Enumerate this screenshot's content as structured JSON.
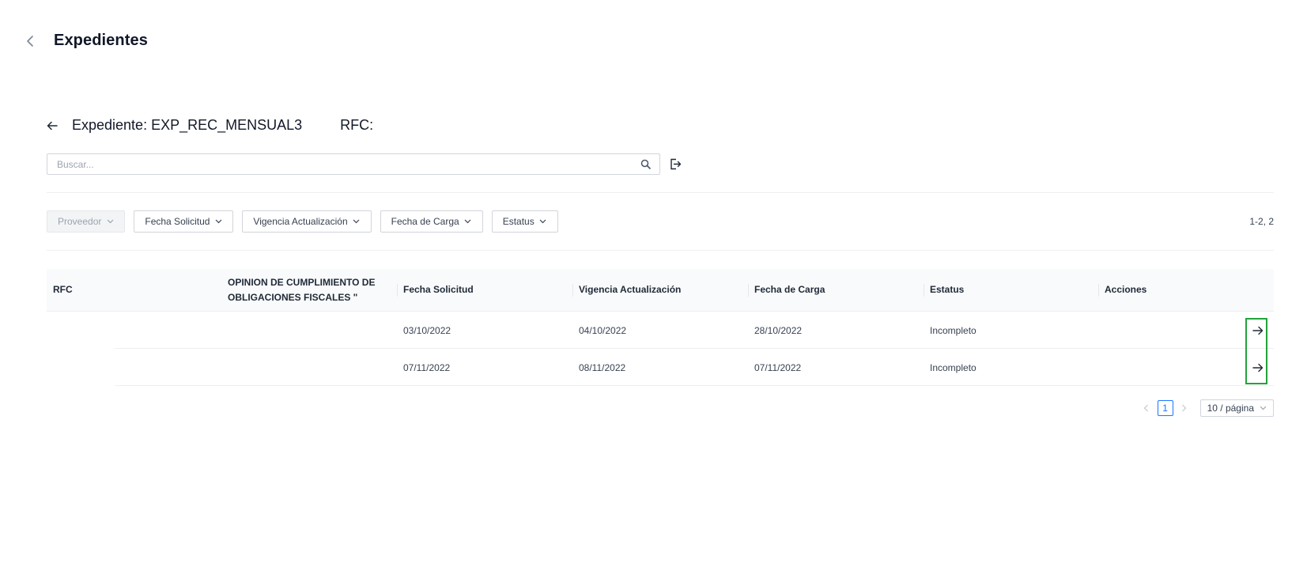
{
  "header": {
    "title": "Expedientes"
  },
  "subheader": {
    "expediente_label": "Expediente: EXP_REC_MENSUAL3",
    "rfc_label": "RFC:"
  },
  "search": {
    "placeholder": "Buscar...",
    "value": ""
  },
  "filters": [
    {
      "label": "Proveedor",
      "disabled": true
    },
    {
      "label": "Fecha Solicitud",
      "disabled": false
    },
    {
      "label": "Vigencia Actualización",
      "disabled": false
    },
    {
      "label": "Fecha de Carga",
      "disabled": false
    },
    {
      "label": "Estatus",
      "disabled": false
    }
  ],
  "range_label": "1-2, 2",
  "table": {
    "headers": {
      "rfc": "RFC",
      "opinion_line1": "OPINION DE CUMPLIMIENTO DE",
      "opinion_line2": "OBLIGACIONES FISCALES \"",
      "fecha_solicitud": "Fecha Solicitud",
      "vigencia": "Vigencia Actualización",
      "fecha_carga": "Fecha de Carga",
      "estatus": "Estatus",
      "acciones": "Acciones"
    },
    "rows": [
      {
        "rfc": "",
        "opinion": "",
        "fecha_solicitud": "03/10/2022",
        "vigencia": "04/10/2022",
        "fecha_carga": "28/10/2022",
        "estatus": "Incompleto"
      },
      {
        "rfc": "",
        "opinion": "",
        "fecha_solicitud": "07/11/2022",
        "vigencia": "08/11/2022",
        "fecha_carga": "07/11/2022",
        "estatus": "Incompleto"
      }
    ]
  },
  "pagination": {
    "current_page": "1",
    "page_size": "10 / página"
  },
  "colors": {
    "highlight": "#22a33a",
    "accent": "#1677ff"
  },
  "icons": {
    "top_back": "chevron-left-icon",
    "sub_back": "arrow-left-icon",
    "search": "search-icon",
    "export": "export-icon",
    "row_action": "arrow-right-icon"
  }
}
